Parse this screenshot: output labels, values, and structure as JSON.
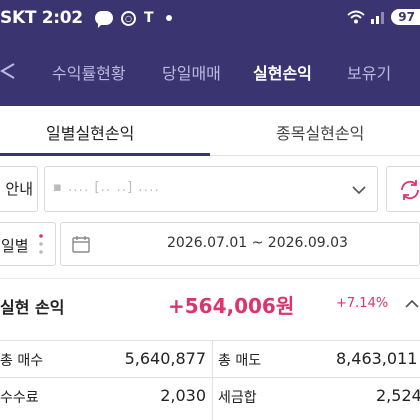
{
  "status_bar": {
    "carrier_time": "SKT 2:02",
    "talk_badge": "TALK",
    "t_label": "T",
    "battery": "97"
  },
  "top_nav": {
    "items": [
      "수익률현황",
      "당일매매",
      "실현손익",
      "보유기"
    ],
    "active_index": 2
  },
  "sub_tabs": {
    "items": [
      "일별실현손익",
      "종목실현손익"
    ],
    "active_index": 0
  },
  "account": {
    "label": "안내",
    "value": "▪        ․․․․ [․․ ․․] ․․․․"
  },
  "period": {
    "label": "일별",
    "range": "2026.07.01 ~ 2026.09.03"
  },
  "summary": {
    "title": "실현 손익",
    "amount": "+564,006원",
    "rate": "+7.14%",
    "total_buy_label": "총 매수",
    "total_buy_value": "5,640,877",
    "total_sell_label": "총 매도",
    "total_sell_value": "8,463,011",
    "fee_label": "수수료",
    "fee_value": "2,030",
    "tax_label": "세금합",
    "tax_value": "2,524"
  },
  "colors": {
    "header_bg": "#3a3470",
    "profit": "#e0336d",
    "refresh": "#e0336d"
  }
}
